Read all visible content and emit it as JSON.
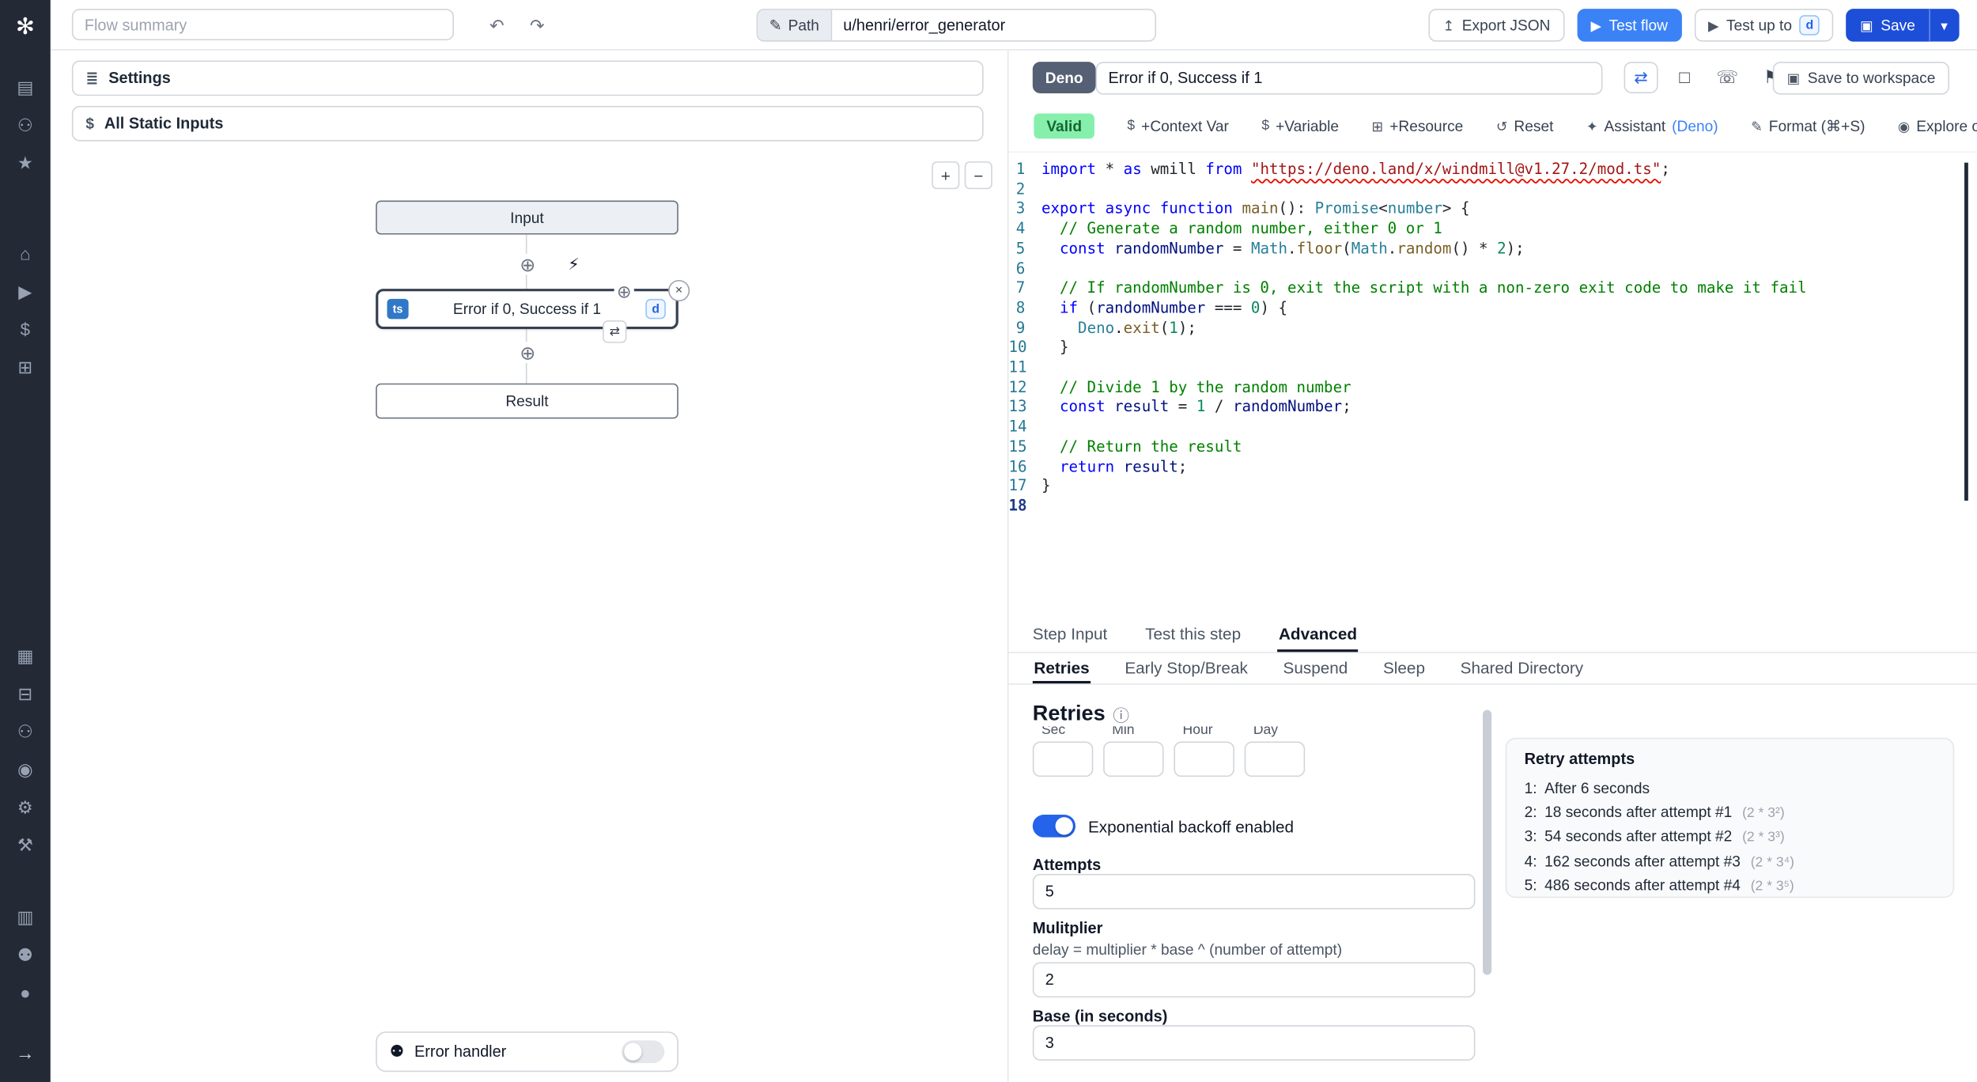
{
  "icons": {
    "logo": "✻",
    "undo": "↶",
    "redo": "↷",
    "pencil": "✎",
    "export": "↥",
    "play": "▶",
    "save": "▣",
    "chevron_down": "▾",
    "sliders": "≣",
    "dollar": "$",
    "zoom_in": "+",
    "zoom_out": "−",
    "plus_circle": "⊕",
    "bolt": "⚡",
    "close": "×",
    "refresh": "⇄",
    "bug": "⚉",
    "info": "ⓘ",
    "loop": "⇄",
    "square": "□",
    "phone": "☏",
    "flag": "⚑"
  },
  "rail": {
    "groupA": [
      {
        "name": "apps",
        "glyph": "▤"
      },
      {
        "name": "user",
        "glyph": "⚇"
      },
      {
        "name": "favorites",
        "glyph": "★"
      }
    ],
    "groupB": [
      {
        "name": "home",
        "glyph": "⌂"
      },
      {
        "name": "runs",
        "glyph": "▶"
      },
      {
        "name": "variables",
        "glyph": "$"
      },
      {
        "name": "resources",
        "glyph": "⊞"
      }
    ],
    "groupC": [
      {
        "name": "schedules",
        "glyph": "▦"
      },
      {
        "name": "folders",
        "glyph": "⊟"
      },
      {
        "name": "groups",
        "glyph": "⚇"
      },
      {
        "name": "audit-logs",
        "glyph": "◉"
      },
      {
        "name": "settings",
        "glyph": "⚙"
      },
      {
        "name": "workers",
        "glyph": "⚒"
      }
    ],
    "groupD": [
      {
        "name": "docs",
        "glyph": "▥"
      },
      {
        "name": "discord",
        "glyph": "⚉"
      },
      {
        "name": "github",
        "glyph": "●"
      }
    ],
    "expand": {
      "glyph": "→"
    }
  },
  "header": {
    "summary_placeholder": "Flow summary",
    "path_label": "Path",
    "path_value": "u/henri/error_generator",
    "export": "Export JSON",
    "test_flow": "Test flow",
    "test_up_to": "Test up to",
    "test_badge": "d",
    "save": "Save"
  },
  "flow": {
    "settings": "Settings",
    "static_inputs": "All Static Inputs",
    "input_node": "Input",
    "step_title": "Error if 0, Success if 1",
    "step_lang": "ts",
    "step_badge": "d",
    "result_node": "Result",
    "error_handler": "Error handler"
  },
  "editor": {
    "lang": "Deno",
    "title": "Error if 0, Success if 1",
    "save_to_workspace": "Save to workspace"
  },
  "toolbar": {
    "valid": "Valid",
    "items": [
      {
        "name": "context-var",
        "icon": "$",
        "label": "+Context Var"
      },
      {
        "name": "variable",
        "icon": "$",
        "label": "+Variable"
      },
      {
        "name": "resource",
        "icon": "⊞",
        "label": "+Resource"
      },
      {
        "name": "reset",
        "icon": "↺",
        "label": "Reset"
      },
      {
        "name": "assistant",
        "icon": "✦",
        "label": "Assistant ",
        "label2": "(Deno)"
      },
      {
        "name": "format",
        "icon": "✎",
        "label": "Format (⌘+S)"
      },
      {
        "name": "explore",
        "icon": "◉",
        "label": "Explore other s"
      }
    ]
  },
  "code": {
    "active_line": 18,
    "lines": [
      [
        [
          "k",
          "import"
        ],
        [
          "p",
          " * "
        ],
        [
          "k",
          "as"
        ],
        [
          "p",
          " wmill "
        ],
        [
          "k",
          "from"
        ],
        [
          "p",
          " "
        ],
        [
          "s",
          "\"https://deno.land/x/windmill@v1.27.2/mod.ts\""
        ],
        [
          "p",
          ";"
        ]
      ],
      [],
      [
        [
          "k",
          "export"
        ],
        [
          "p",
          " "
        ],
        [
          "k",
          "async"
        ],
        [
          "p",
          " "
        ],
        [
          "k",
          "function"
        ],
        [
          "p",
          " "
        ],
        [
          "f",
          "main"
        ],
        [
          "p",
          "(): "
        ],
        [
          "t",
          "Promise"
        ],
        [
          "p",
          "<"
        ],
        [
          "t",
          "number"
        ],
        [
          "p",
          "> {"
        ]
      ],
      [
        [
          "c",
          "  // Generate a random number, either 0 or 1"
        ]
      ],
      [
        [
          "p",
          "  "
        ],
        [
          "k",
          "const"
        ],
        [
          "p",
          " "
        ],
        [
          "v",
          "randomNumber"
        ],
        [
          "p",
          " = "
        ],
        [
          "t",
          "Math"
        ],
        [
          "p",
          "."
        ],
        [
          "f",
          "floor"
        ],
        [
          "p",
          "("
        ],
        [
          "t",
          "Math"
        ],
        [
          "p",
          "."
        ],
        [
          "f",
          "random"
        ],
        [
          "p",
          "() * "
        ],
        [
          "n",
          "2"
        ],
        [
          "p",
          ");"
        ]
      ],
      [],
      [
        [
          "c",
          "  // If randomNumber is 0, exit the script with a non-zero exit code to make it fail"
        ]
      ],
      [
        [
          "p",
          "  "
        ],
        [
          "k",
          "if"
        ],
        [
          "p",
          " ("
        ],
        [
          "v",
          "randomNumber"
        ],
        [
          "p",
          " === "
        ],
        [
          "n",
          "0"
        ],
        [
          "p",
          ") {"
        ]
      ],
      [
        [
          "p",
          "    "
        ],
        [
          "t",
          "Deno"
        ],
        [
          "p",
          "."
        ],
        [
          "f",
          "exit"
        ],
        [
          "p",
          "("
        ],
        [
          "n",
          "1"
        ],
        [
          "p",
          ");"
        ]
      ],
      [
        [
          "p",
          "  }"
        ]
      ],
      [],
      [
        [
          "c",
          "  // Divide 1 by the random number"
        ]
      ],
      [
        [
          "p",
          "  "
        ],
        [
          "k",
          "const"
        ],
        [
          "p",
          " "
        ],
        [
          "v",
          "result"
        ],
        [
          "p",
          " = "
        ],
        [
          "n",
          "1"
        ],
        [
          "p",
          " / "
        ],
        [
          "v",
          "randomNumber"
        ],
        [
          "p",
          ";"
        ]
      ],
      [],
      [
        [
          "c",
          "  // Return the result"
        ]
      ],
      [
        [
          "p",
          "  "
        ],
        [
          "k",
          "return"
        ],
        [
          "p",
          " "
        ],
        [
          "v",
          "result"
        ],
        [
          "p",
          ";"
        ]
      ],
      [
        [
          "p",
          "}"
        ]
      ],
      []
    ]
  },
  "panel_tabs": [
    {
      "label": "Step Input",
      "active": false
    },
    {
      "label": "Test this step",
      "active": false
    },
    {
      "label": "Advanced",
      "active": true
    }
  ],
  "advanced_tabs": [
    {
      "label": "Retries",
      "active": true
    },
    {
      "label": "Early Stop/Break",
      "active": false
    },
    {
      "label": "Suspend",
      "active": false
    },
    {
      "label": "Sleep",
      "active": false
    },
    {
      "label": "Shared Directory",
      "active": false
    }
  ],
  "retries": {
    "heading": "Retries",
    "time_labels": [
      "Sec",
      "Min",
      "Hour",
      "Day"
    ],
    "exponential_label": "Exponential backoff enabled",
    "attempts_label": "Attempts",
    "attempts_value": "5",
    "multiplier_label": "Mulitplier",
    "multiplier_help": "delay = multiplier * base ^ (number of attempt)",
    "multiplier_value": "2",
    "base_label": "Base (in seconds)",
    "base_value": "3"
  },
  "retry_attempts": {
    "title": "Retry attempts",
    "rows": [
      {
        "n": "1:",
        "text": "After 6 seconds",
        "formula": ""
      },
      {
        "n": "2:",
        "text": "18 seconds after attempt #1",
        "formula": "(2 * 3²)"
      },
      {
        "n": "3:",
        "text": "54 seconds after attempt #2",
        "formula": "(2 * 3³)"
      },
      {
        "n": "4:",
        "text": "162 seconds after attempt #3",
        "formula": "(2 * 3⁴)"
      },
      {
        "n": "5:",
        "text": "486 seconds after attempt #4",
        "formula": "(2 * 3⁵)"
      }
    ]
  }
}
